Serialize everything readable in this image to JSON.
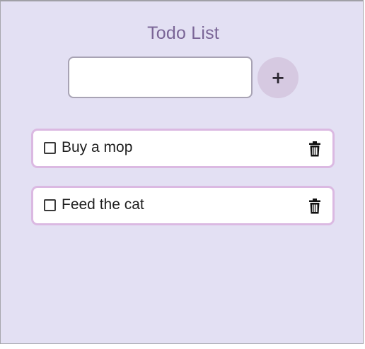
{
  "header": {
    "title": "Todo List"
  },
  "input": {
    "value": "",
    "placeholder": ""
  },
  "add_button": {
    "label": "+"
  },
  "todos": [
    {
      "text": "Buy a mop",
      "checked": false
    },
    {
      "text": "Feed the cat",
      "checked": false
    }
  ],
  "icons": {
    "delete": "trash-icon",
    "add": "plus-icon",
    "checkbox": "checkbox-icon"
  },
  "colors": {
    "background": "#e3e0f3",
    "title": "#7a6596",
    "add_button": "#d6c9e1",
    "item_border": "#dbb9e2"
  }
}
